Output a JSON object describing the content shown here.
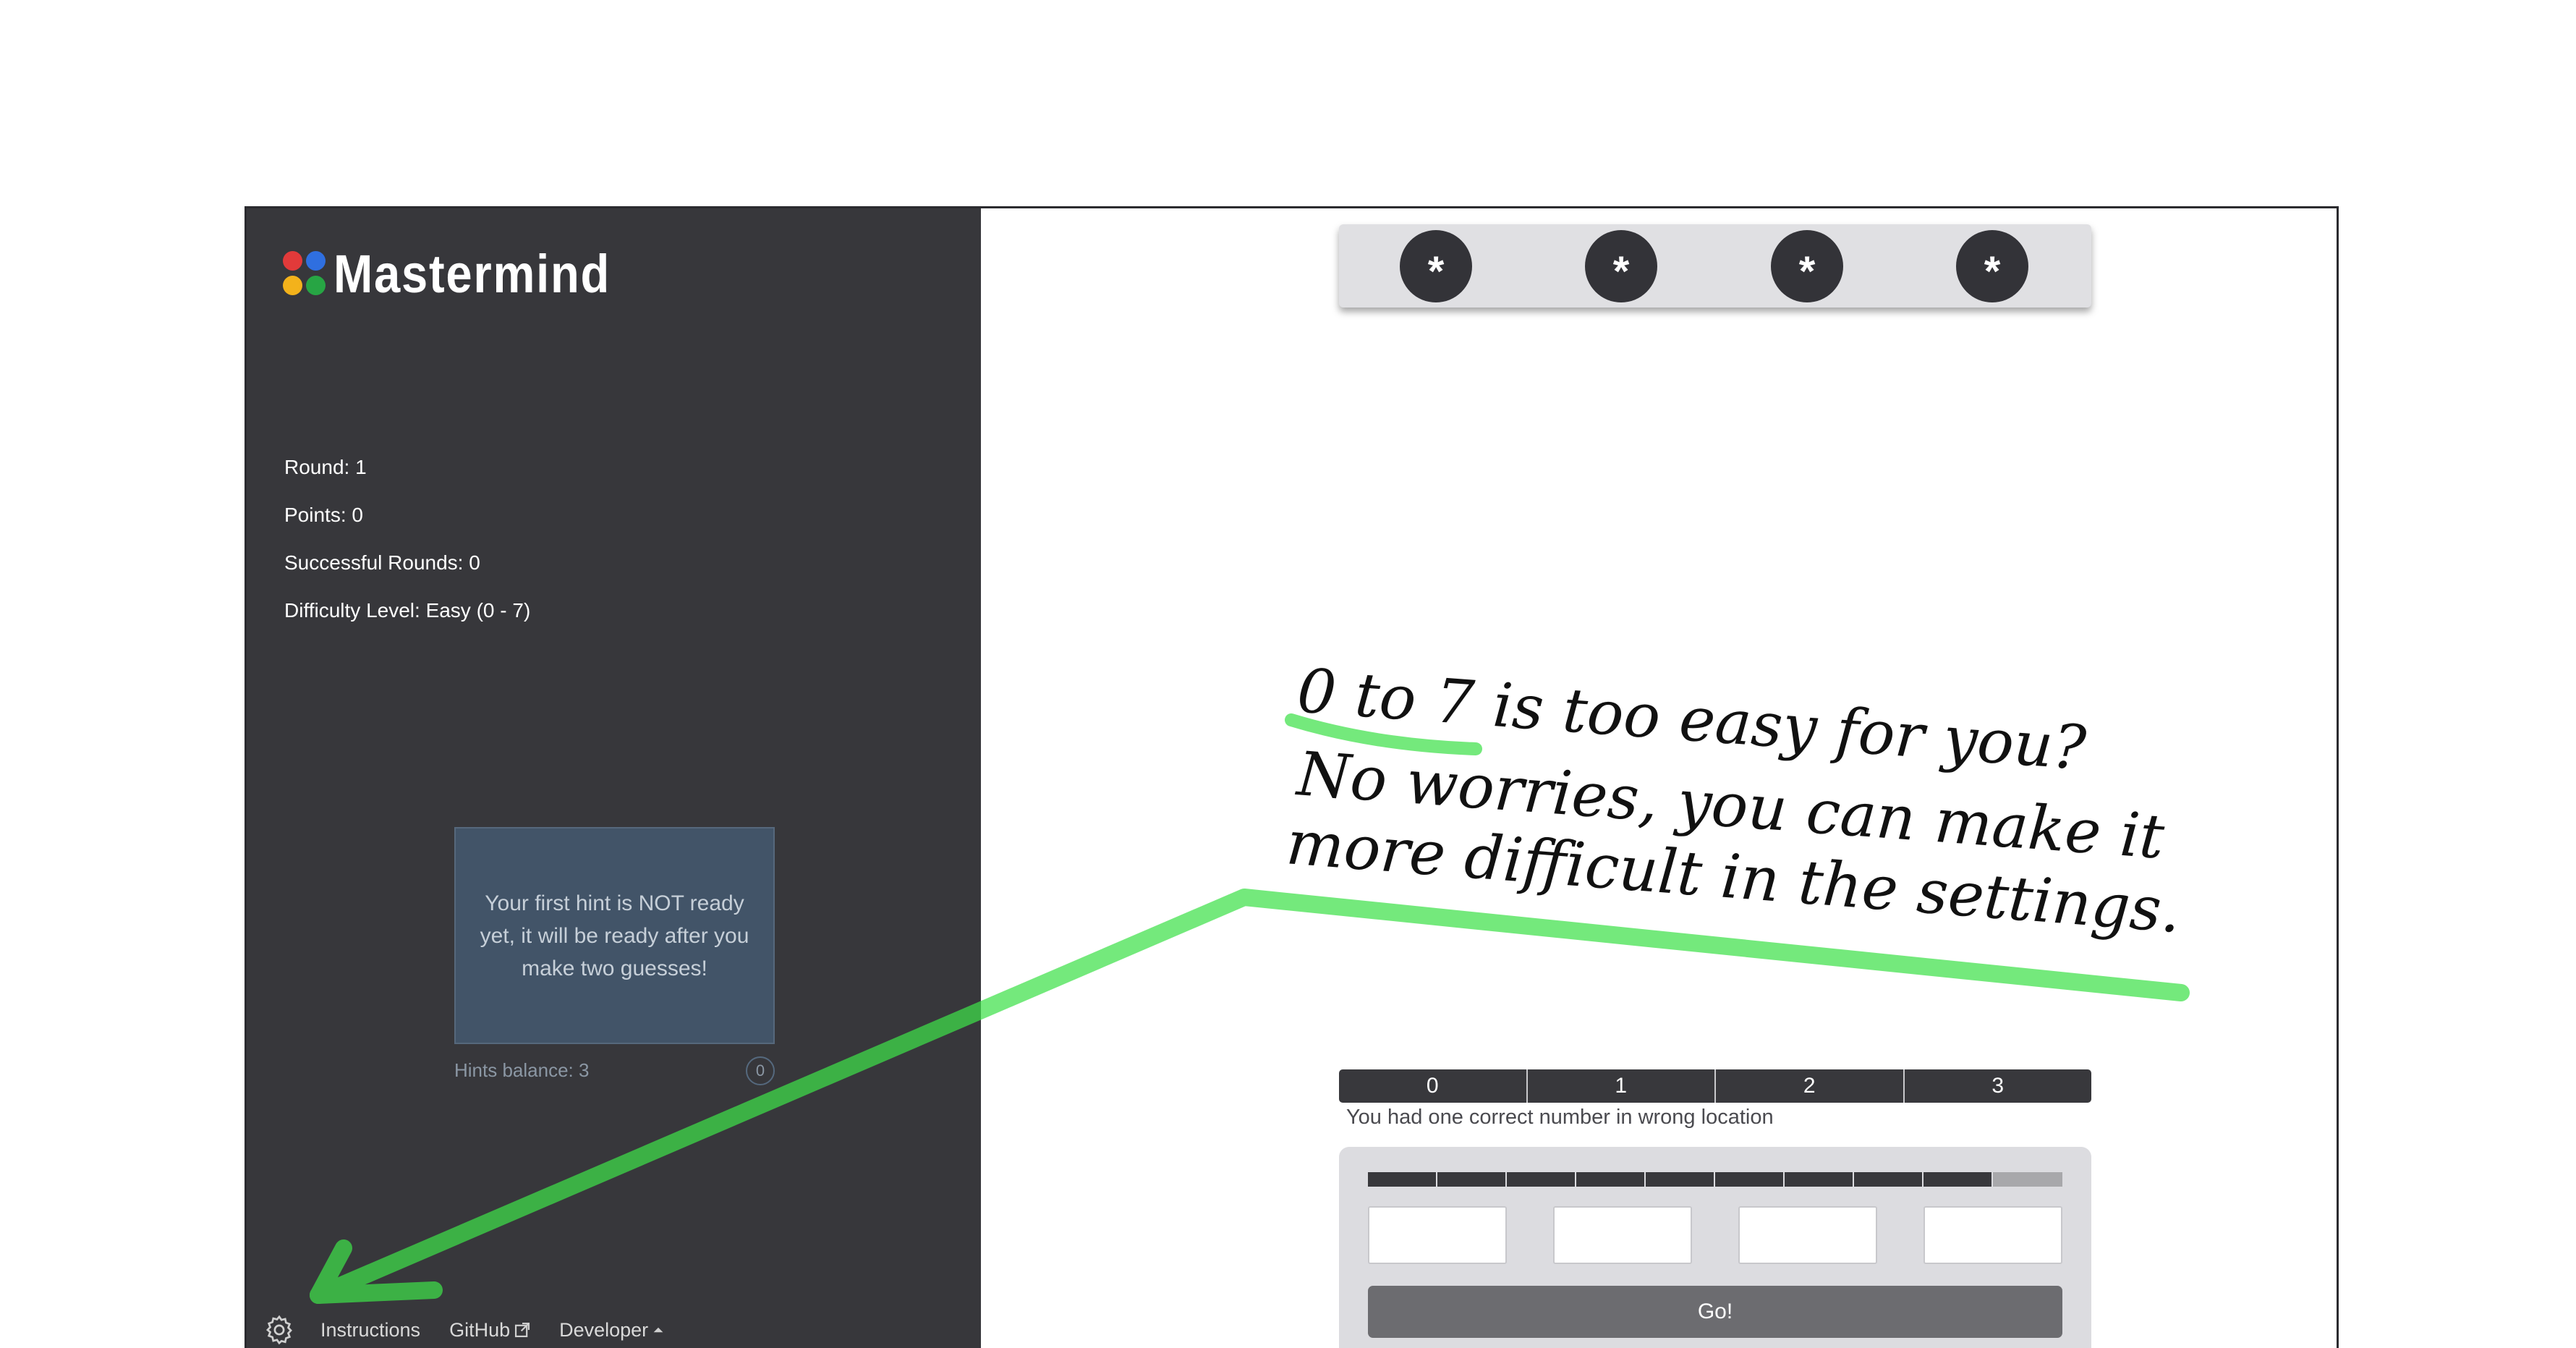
{
  "app": {
    "logo_text": "Mastermind",
    "logo_dot_colors": [
      "#e23a3a",
      "#2f6fe0",
      "#f3b21b",
      "#27a544"
    ]
  },
  "stats": {
    "round": "Round: 1",
    "points": "Points: 0",
    "successful_rounds": "Successful Rounds: 0",
    "difficulty": "Difficulty Level: Easy (0 - 7)"
  },
  "hint": {
    "message": "Your first hint is NOT ready yet, it will be ready after you make two guesses!",
    "balance_label": "Hints balance: 3",
    "count": "0"
  },
  "footer": {
    "settings_icon": "gear-icon",
    "instructions": "Instructions",
    "github": "GitHub",
    "github_icon": "external-link-icon",
    "developer": "Developer",
    "developer_icon": "caret-up-icon"
  },
  "secret": {
    "pegs": [
      "*",
      "*",
      "*",
      "*"
    ]
  },
  "board": {
    "positions": [
      "0",
      "1",
      "2",
      "3"
    ],
    "feedback": "You had one correct number in wrong location",
    "attempts_used": 9,
    "attempts_total": 10,
    "guess_values": [
      "",
      "",
      "",
      ""
    ],
    "go_label": "Go!"
  },
  "annotation": {
    "lines": [
      "0 to 7 is too easy for you?",
      "No worries, you can make it",
      "more difficult in the settings."
    ],
    "highlight_color": "#3ee04a"
  }
}
